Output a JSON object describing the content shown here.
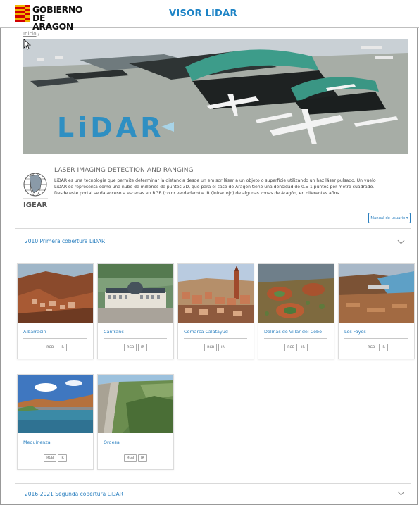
{
  "header": {
    "logo_line1": "GOBIERNO",
    "logo_line2": "DE ARAGON",
    "app_title": "VISOR LiDAR"
  },
  "breadcrumb": {
    "home": "Inicio",
    "separator": "/"
  },
  "hero": {
    "wordmark": "LiDAR"
  },
  "about": {
    "logo_label": "IGEAR",
    "title": "LASER IMAGING DETECTION AND RANGING",
    "text": "LiDAR es una tecnología que permite determinar la distancia desde un emisor láser a un objeto o superficie utilizando un haz láser pulsado. Un vuelo LiDAR se representa como una nube de millones de puntos 3D, que para el caso de Aragón tiene una densidad de 0.5-1 puntos por metro cuadrado. Desde este portal se da acceso a escenas en RGB (color verdadero) e IR (infrarrojo) de algunas zonas de Aragón, en diferentes años.",
    "manual_button": "Manual de usuario ▾"
  },
  "sections": [
    {
      "title": "2010 Primera cobertura LiDAR"
    },
    {
      "title": "2016-2021 Segunda cobertura LiDAR"
    }
  ],
  "cards": [
    {
      "name": "Albarracín",
      "rgb": "RGB",
      "ir": "IR"
    },
    {
      "name": "Canfranc",
      "rgb": "RGB",
      "ir": "IR"
    },
    {
      "name": "Comarca Calatayud",
      "rgb": "RGB",
      "ir": "IR"
    },
    {
      "name": "Dolinas de Villar del Cobo",
      "rgb": "RGB",
      "ir": "IR"
    },
    {
      "name": "Los Fayos",
      "rgb": "RGB",
      "ir": "IR"
    },
    {
      "name": "Mequinenza",
      "rgb": "RGB",
      "ir": "IR"
    },
    {
      "name": "Ordesa",
      "rgb": "RGB",
      "ir": "IR"
    }
  ],
  "colors": {
    "accent": "#2a7fbf",
    "title_blue": "#1e84c6",
    "logo_red": "#d10000",
    "logo_yellow": "#f2b600"
  },
  "icons": {
    "cursor": "cursor-arrow-icon",
    "chevron": "chevron-down-icon",
    "igear": "globe-map-icon"
  }
}
